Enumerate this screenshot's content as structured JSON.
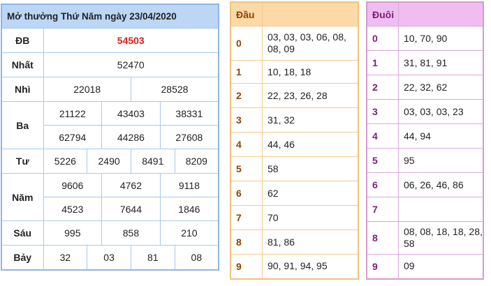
{
  "results": {
    "title": "Mở thưởng Thứ Năm ngày 23/04/2020",
    "db": {
      "label": "ĐB",
      "value": "54503"
    },
    "nhat": {
      "label": "Nhất",
      "value": "52470"
    },
    "nhi": {
      "label": "Nhì",
      "values": [
        "22018",
        "28528"
      ]
    },
    "ba": {
      "label": "Ba",
      "values": [
        "21122",
        "43403",
        "38331",
        "62794",
        "44286",
        "27608"
      ]
    },
    "tu": {
      "label": "Tư",
      "values": [
        "5226",
        "2490",
        "8491",
        "8209"
      ]
    },
    "nam": {
      "label": "Năm",
      "values": [
        "9606",
        "4762",
        "9118",
        "4523",
        "7644",
        "1846"
      ]
    },
    "sau": {
      "label": "Sáu",
      "values": [
        "995",
        "858",
        "210"
      ]
    },
    "bay": {
      "label": "Bảy",
      "values": [
        "32",
        "03",
        "81",
        "08"
      ]
    }
  },
  "dau": {
    "header": "Đầu",
    "rows": [
      {
        "key": "0",
        "value": "03, 03, 03, 06, 08, 08, 09"
      },
      {
        "key": "1",
        "value": "10, 18, 18"
      },
      {
        "key": "2",
        "value": "22, 23, 26, 28"
      },
      {
        "key": "3",
        "value": "31, 32"
      },
      {
        "key": "4",
        "value": "44, 46"
      },
      {
        "key": "5",
        "value": "58"
      },
      {
        "key": "6",
        "value": "62"
      },
      {
        "key": "7",
        "value": "70"
      },
      {
        "key": "8",
        "value": "81, 86"
      },
      {
        "key": "9",
        "value": "90, 91, 94, 95"
      }
    ]
  },
  "duoi": {
    "header": "Đuôi",
    "rows": [
      {
        "key": "0",
        "value": "10, 70, 90"
      },
      {
        "key": "1",
        "value": "31, 81, 91"
      },
      {
        "key": "2",
        "value": "22, 32, 62"
      },
      {
        "key": "3",
        "value": "03, 03, 03, 23"
      },
      {
        "key": "4",
        "value": "44, 94"
      },
      {
        "key": "5",
        "value": "95"
      },
      {
        "key": "6",
        "value": "06, 26, 46, 86"
      },
      {
        "key": "7",
        "value": ""
      },
      {
        "key": "8",
        "value": "08, 08, 18, 18, 28, 58"
      },
      {
        "key": "9",
        "value": "09"
      }
    ]
  },
  "colors": {
    "results_header": "#bcd6f5",
    "dau_header": "#fcd9a6",
    "duoi_header": "#efbdef",
    "special_prize": "#e01b1b"
  }
}
